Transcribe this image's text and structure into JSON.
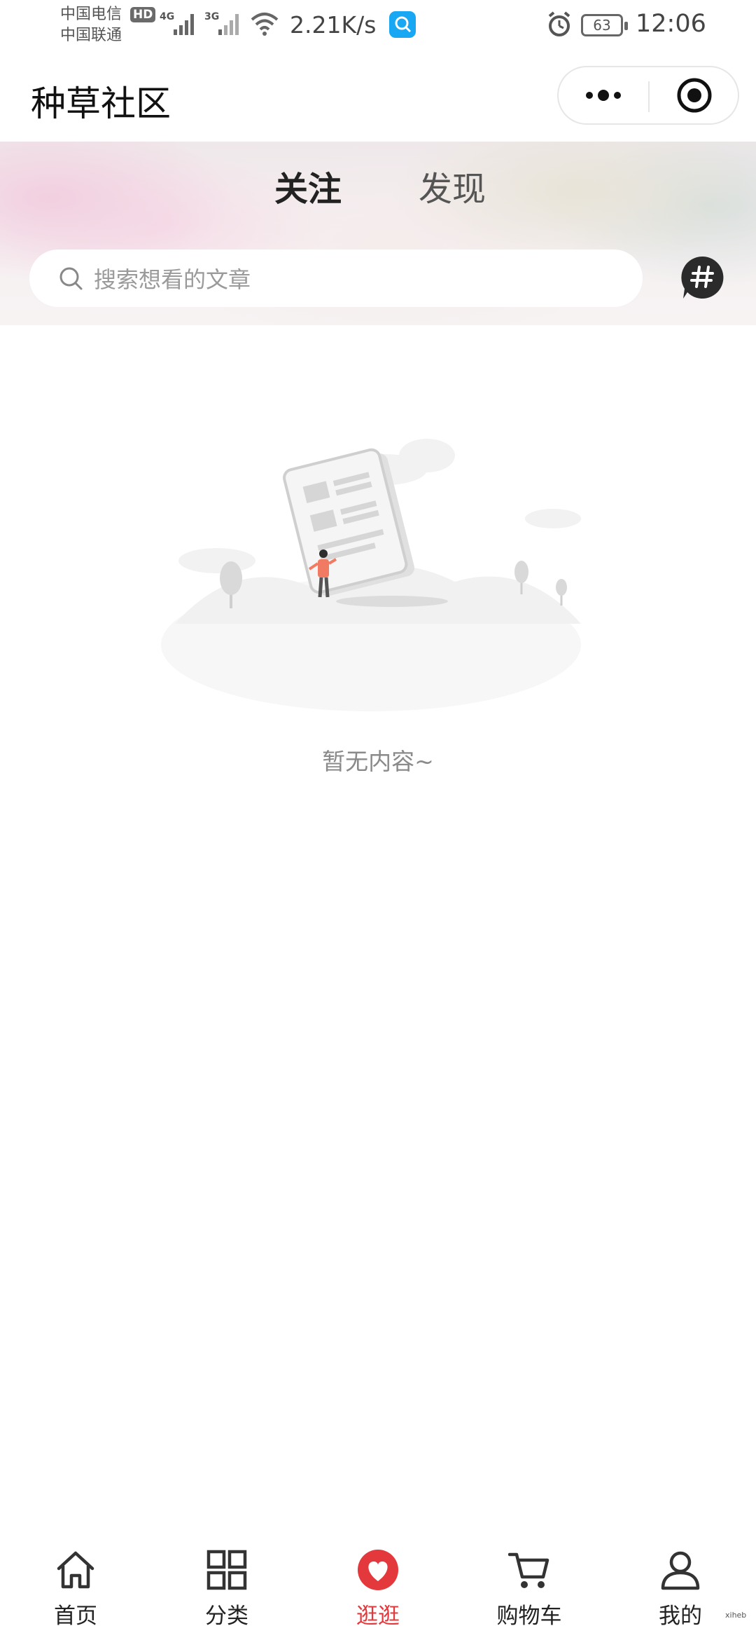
{
  "status_bar": {
    "carrier1": "中国电信",
    "carrier2": "中国联通",
    "hd_badge": "HD",
    "sig1_label": "4G",
    "sig2_label": "3G",
    "net_speed": "2.21K/s",
    "battery": "63",
    "time": "12:06"
  },
  "header": {
    "title": "种草社区"
  },
  "tabs": {
    "follow": "关注",
    "discover": "发现"
  },
  "search": {
    "placeholder": "搜索想看的文章"
  },
  "empty_state": {
    "text": "暂无内容~"
  },
  "tab_bar": {
    "items": [
      {
        "label": "首页",
        "icon": "home-icon"
      },
      {
        "label": "分类",
        "icon": "category-icon"
      },
      {
        "label": "逛逛",
        "icon": "heart-icon"
      },
      {
        "label": "购物车",
        "icon": "cart-icon"
      },
      {
        "label": "我的",
        "icon": "user-icon"
      }
    ],
    "active_index": 2
  },
  "colors": {
    "accent": "#e4393c",
    "search_app": "#17a7f3"
  },
  "corner_mark": "xiheb"
}
